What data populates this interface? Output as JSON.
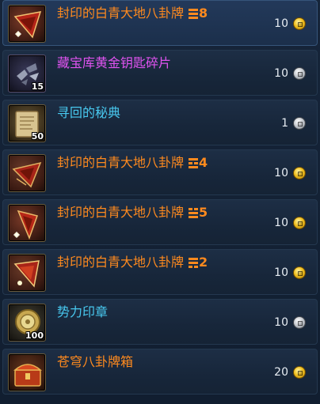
{
  "items": [
    {
      "name": "封印的白青大地八卦牌",
      "tier": "8",
      "name_color": "orange",
      "price": "10",
      "currency": "gold",
      "qty": "",
      "icon": "sealed-tablet-icon"
    },
    {
      "name": "藏宝库黄金钥匙碎片",
      "tier": "",
      "name_color": "purple",
      "price": "10",
      "currency": "silver",
      "qty": "15",
      "icon": "key-fragment-icon"
    },
    {
      "name": "寻回的秘典",
      "tier": "",
      "name_color": "cyan",
      "price": "1",
      "currency": "silver",
      "qty": "50",
      "icon": "scroll-book-icon"
    },
    {
      "name": "封印的白青大地八卦牌",
      "tier": "4",
      "name_color": "orange",
      "price": "10",
      "currency": "gold",
      "qty": "",
      "icon": "sealed-tablet-icon"
    },
    {
      "name": "封印的白青大地八卦牌",
      "tier": "5",
      "name_color": "orange",
      "price": "10",
      "currency": "gold",
      "qty": "",
      "icon": "sealed-tablet-icon"
    },
    {
      "name": "封印的白青大地八卦牌",
      "tier": "2",
      "name_color": "orange",
      "price": "10",
      "currency": "gold",
      "qty": "",
      "icon": "sealed-tablet-icon"
    },
    {
      "name": "势力印章",
      "tier": "",
      "name_color": "cyan",
      "price": "10",
      "currency": "silver",
      "qty": "100",
      "icon": "faction-seal-icon"
    },
    {
      "name": "苍穹八卦牌箱",
      "tier": "",
      "name_color": "orange",
      "price": "20",
      "currency": "gold",
      "qty": "",
      "icon": "tablet-chest-icon"
    }
  ],
  "colors": {
    "orange": "#ff8a1e",
    "purple": "#e053f0",
    "cyan": "#48c8ef",
    "gold": "#f0c020",
    "silver": "#c8ccd2"
  }
}
